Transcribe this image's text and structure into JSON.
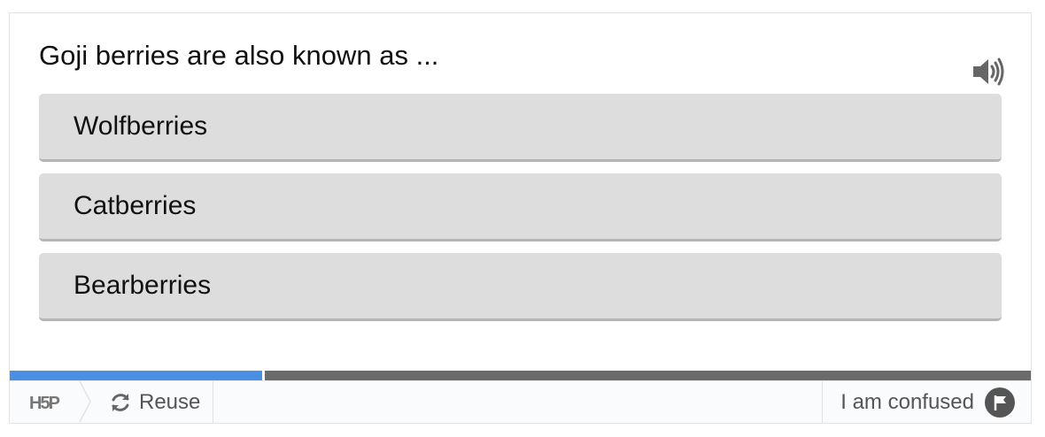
{
  "question": {
    "text": "Goji berries are also known as ..."
  },
  "audio": {
    "icon": "speaker-icon"
  },
  "answers": [
    {
      "label": "Wolfberries"
    },
    {
      "label": "Catberries"
    },
    {
      "label": "Bearberries"
    }
  ],
  "progress": {
    "fraction": 0.25,
    "fill_color": "#4a90e2",
    "track_color": "#6b6b6b"
  },
  "footer": {
    "logo_text": "H5P",
    "reuse_label": "Reuse",
    "confused_label": "I am confused"
  }
}
